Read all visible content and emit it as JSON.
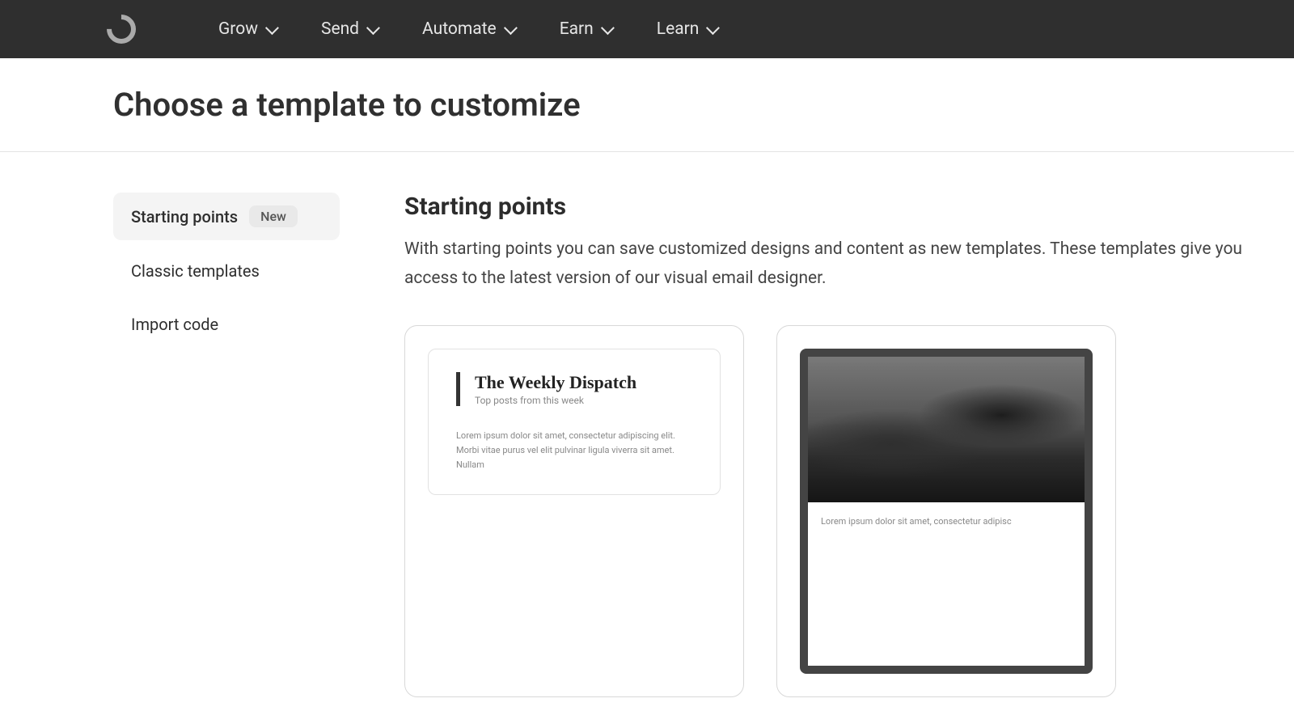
{
  "nav": {
    "items": [
      "Grow",
      "Send",
      "Automate",
      "Earn",
      "Learn"
    ]
  },
  "page": {
    "title": "Choose a template to customize"
  },
  "sidebar": {
    "items": [
      {
        "label": "Starting points",
        "badge": "New",
        "active": true
      },
      {
        "label": "Classic templates"
      },
      {
        "label": "Import code"
      }
    ]
  },
  "section": {
    "title": "Starting points",
    "description": "With starting points you can save customized designs and content as new templates. These templates give you access to the latest version of our visual email designer."
  },
  "templates": [
    {
      "kind": "newsletter",
      "title": "The Weekly Dispatch",
      "subtitle": "Top posts from this week",
      "body": "Lorem ipsum dolor sit amet, consectetur adipiscing elit. Morbi vitae purus vel elit pulvinar ligula viverra sit amet. Nullam"
    },
    {
      "kind": "image-hero",
      "body": "Lorem ipsum dolor sit amet, consectetur adipisc"
    }
  ]
}
